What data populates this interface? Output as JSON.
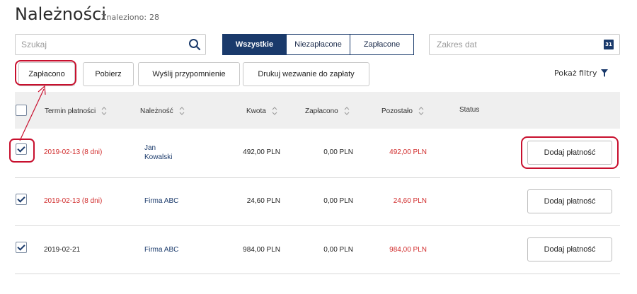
{
  "header": {
    "title": "Należności",
    "found_label": "Znaleziono:",
    "found_count": "28"
  },
  "search": {
    "placeholder": "Szukaj",
    "value": ""
  },
  "segmented": [
    "Wszystkie",
    "Niezapłacone",
    "Zapłacone"
  ],
  "date_range": {
    "placeholder": "Zakres dat",
    "calendar_icon_text": "31"
  },
  "actions": [
    "Zapłacono",
    "Pobierz",
    "Wyślij przypomnienie",
    "Drukuj wezwanie do zapłaty"
  ],
  "filters_label": "Pokaż filtry",
  "columns": [
    "Termin płatności",
    "Należność",
    "Kwota",
    "Zapłacono",
    "Pozostało",
    "Status"
  ],
  "rows": [
    {
      "checked": true,
      "due": "2019-02-13 (8 dni)",
      "overdue": true,
      "payer_line1": "Jan",
      "payer_line2": "Kowalski",
      "amount": "492,00 PLN",
      "paid": "0,00 PLN",
      "remaining": "492,00 PLN",
      "status": "",
      "action": "Dodaj płatność"
    },
    {
      "checked": true,
      "due": "2019-02-13 (8 dni)",
      "overdue": true,
      "payer_line1": "Firma ABC",
      "payer_line2": "",
      "amount": "24,60 PLN",
      "paid": "0,00 PLN",
      "remaining": "24,60 PLN",
      "status": "",
      "action": "Dodaj płatność"
    },
    {
      "checked": true,
      "due": "2019-02-21",
      "overdue": false,
      "payer_line1": "Firma ABC",
      "payer_line2": "",
      "amount": "984,00 PLN",
      "paid": "0,00 PLN",
      "remaining": "984,00 PLN",
      "status": "",
      "action": "Dodaj płatność"
    }
  ],
  "colors": {
    "accent": "#1a3a6b",
    "overdue": "#d12c2c",
    "annotation": "#c8102e",
    "header_bg": "#efefef"
  }
}
